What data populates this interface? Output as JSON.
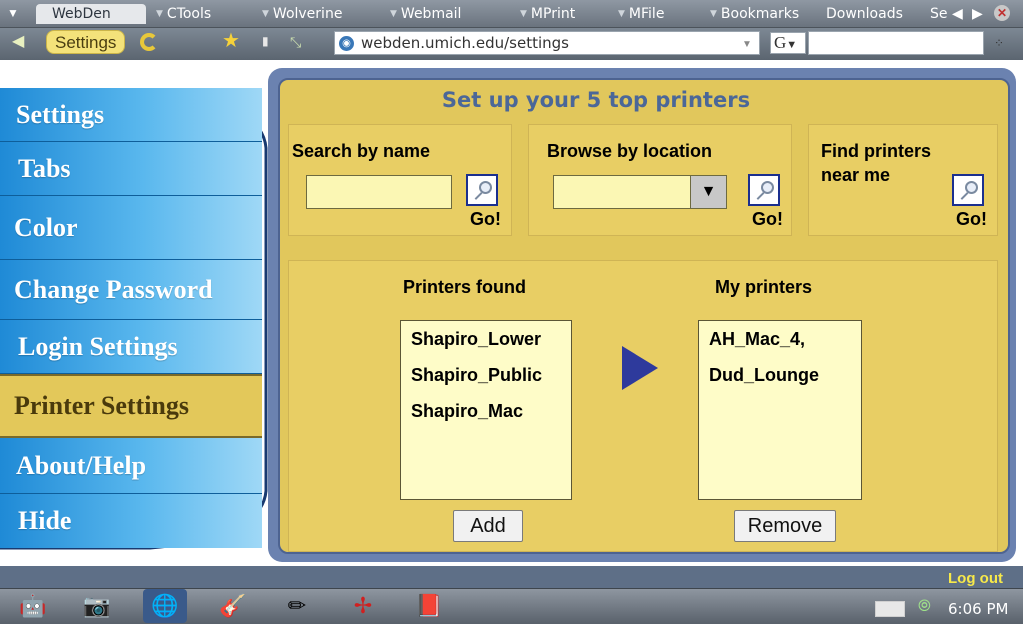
{
  "browser": {
    "tabs": [
      {
        "label": "WebDen",
        "active": true
      },
      {
        "label": "CTools"
      },
      {
        "label": "Wolverine"
      },
      {
        "label": "Webmail"
      },
      {
        "label": "MPrint"
      },
      {
        "label": "MFile"
      },
      {
        "label": "Bookmarks"
      },
      {
        "label": "Downloads"
      },
      {
        "label": "Se"
      }
    ],
    "settings_chip": "Settings",
    "url": "webden.umich.edu/settings",
    "search_engine": "G",
    "icons": {
      "menu": "dropdown-triangle-icon",
      "back": "back-arrow-icon",
      "reload": "reload-icon",
      "star": "star-icon",
      "fullscreen": "fullscreen-icon",
      "prev": "prev-tab-icon",
      "next": "next-tab-icon",
      "close": "close-icon"
    }
  },
  "sidebar": {
    "items": [
      {
        "label": "Settings"
      },
      {
        "label": "Tabs"
      },
      {
        "label": "Color"
      },
      {
        "label": "Change Password"
      },
      {
        "label": "Login Settings"
      },
      {
        "label": "Printer Settings",
        "active": true
      },
      {
        "label": "About/Help"
      },
      {
        "label": "Hide"
      }
    ]
  },
  "main": {
    "title": "Set up your 5 top printers",
    "search": {
      "label": "Search by name",
      "go": "Go!",
      "value": ""
    },
    "browse": {
      "label": "Browse by location",
      "go": "Go!",
      "value": ""
    },
    "nearby": {
      "label_line1": "Find printers",
      "label_line2": "near me",
      "go": "Go!"
    },
    "found": {
      "heading": "Printers found",
      "items": [
        "Shapiro_Lower",
        "Shapiro_Public",
        "Shapiro_Mac"
      ],
      "add_label": "Add"
    },
    "mine": {
      "heading": "My printers",
      "items": [
        "AH_Mac_4,",
        "Dud_Lounge"
      ],
      "remove_label": "Remove"
    }
  },
  "footer": {
    "logout": "Log out",
    "clock": "6:06 PM"
  },
  "colors": {
    "panel_bg": "#e1c75c",
    "panel_border": "#6b82b0",
    "title": "#4b6798",
    "sidebar_blue": "#1f8ad6",
    "sidebar_active": "#e3c85a",
    "list_bg": "#fefcc8",
    "logout": "#f7e94a"
  }
}
